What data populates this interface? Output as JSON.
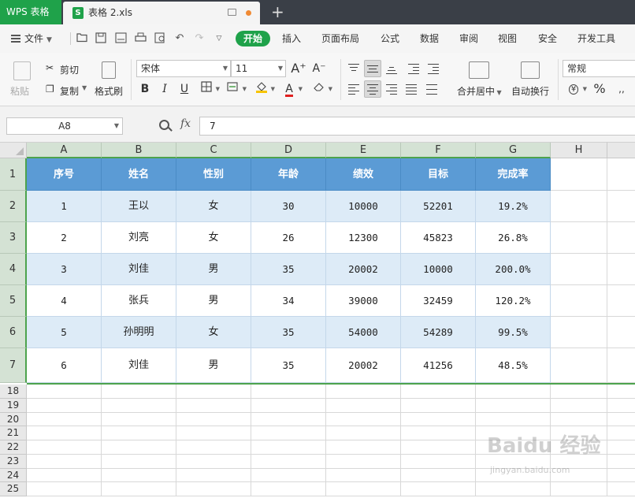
{
  "titlebar": {
    "app_name": "WPS 表格",
    "file_tab": {
      "icon_letter": "S",
      "name": "表格 2.xls"
    },
    "add_tab": "+"
  },
  "menubar": {
    "file_label": "文件",
    "tabs": [
      "开始",
      "插入",
      "页面布局",
      "公式",
      "数据",
      "审阅",
      "视图",
      "安全",
      "开发工具"
    ],
    "active_tab": "开始"
  },
  "ribbon": {
    "paste_label": "粘贴",
    "cut_label": "剪切",
    "copy_label": "复制",
    "format_painter_label": "格式刷",
    "font_name": "宋体",
    "font_size": "11",
    "bold": "B",
    "italic": "I",
    "underline": "U",
    "font_color_glyph": "A",
    "merge_label": "合并居中",
    "wrap_label": "自动换行",
    "number_format": "常规",
    "percent": "%",
    "currency": "¥",
    "grow_font": "A⁺",
    "shrink_font": "A⁻"
  },
  "formula_bar": {
    "cell_ref": "A8",
    "fx_label": "fx",
    "value": "7"
  },
  "grid": {
    "columns": [
      "A",
      "B",
      "C",
      "D",
      "E",
      "F",
      "G",
      "H"
    ],
    "row_numbers": [
      "1",
      "2",
      "3",
      "4",
      "5",
      "6",
      "7",
      "18",
      "19",
      "20",
      "21",
      "22",
      "23",
      "24",
      "25"
    ],
    "header": [
      "序号",
      "姓名",
      "性别",
      "年龄",
      "绩效",
      "目标",
      "完成率"
    ],
    "rows": [
      [
        "1",
        "王以",
        "女",
        "30",
        "10000",
        "52201",
        "19.2%"
      ],
      [
        "2",
        "刘亮",
        "女",
        "26",
        "12300",
        "45823",
        "26.8%"
      ],
      [
        "3",
        "刘佳",
        "男",
        "35",
        "20002",
        "10000",
        "200.0%"
      ],
      [
        "4",
        "张兵",
        "男",
        "34",
        "39000",
        "32459",
        "120.2%"
      ],
      [
        "5",
        "孙明明",
        "女",
        "35",
        "54000",
        "54289",
        "99.5%"
      ],
      [
        "6",
        "刘佳",
        "男",
        "35",
        "20002",
        "41256",
        "48.5%"
      ]
    ]
  },
  "watermark": {
    "main": "Baidu 经验",
    "sub": "jingyan.baidu.com"
  },
  "colors": {
    "accent_green": "#1fa24a",
    "table_header_blue": "#5b9bd5",
    "band_blue": "#ddebf7"
  }
}
